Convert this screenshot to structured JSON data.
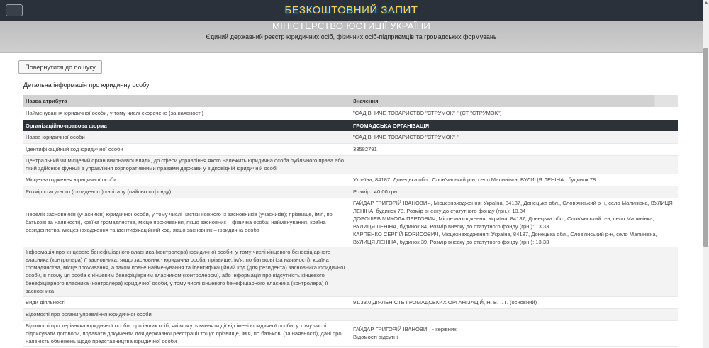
{
  "header": {
    "free_request": "БЕЗКОШТОВНИЙ ЗАПИТ",
    "ministry": "МІНІСТЕРСТВО ЮСТИЦІЇ УКРАЇНИ",
    "registry": "Єдиний державний реєстр юридичних осіб, фізичних осіб-підприємців та громадських формувань"
  },
  "toolbar": {
    "back_label": "Повернутися до пошуку"
  },
  "section_title": "Детальна інформація про юридичну особу",
  "table": {
    "headers": [
      "Назва атрибута",
      "Значення"
    ],
    "rows": [
      {
        "attr": "Найменування юридичної особи, у тому числі скорочене (за наявності)",
        "value": "\"САДІВНИЧЕ ТОВАРИСТВО \"СТРУМОК\" \" (СТ \"СТРУМОК\")"
      },
      {
        "attr": "Організаційно-правова форма",
        "value": "ГРОМАДСЬКА ОРГАНІЗАЦІЯ"
      },
      {
        "attr": "Назва юридичної особи",
        "value": "\"САДІВНИЧЕ ТОВАРИСТВО \"СТРУМОК\" \""
      },
      {
        "attr": "Ідентифікаційний код юридичної особи",
        "value": "33582791"
      },
      {
        "attr": "Центральний чи місцевий орган виконавчої влади, до сфери управління якого належить юридична особа публічного права або який здійснює функції з управління корпоративними правами держави у відповідній юридичній особі",
        "value": ""
      },
      {
        "attr": "Місцезнаходження юридичної особи",
        "value": "Україна, 84187, Донецька обл., Слов'янський р-н, село Малинівка, ВУЛИЦЯ ЛЕНІНА , будинок 78"
      },
      {
        "attr": "Розмір статутного (складеного) капіталу (пайового фонду)",
        "value": "Розмір : 40,00 грн."
      },
      {
        "attr": "Перелік засновників (учасників) юридичної особи, у тому числі частки кожного із засновників (учасників); прізвище, ім'я, по батькові за наявності), країна громадянства, місце проживання, якщо засновник – фізична особа; найменування, країна резидентства, місцезнаходження та ідентифікаційний код, якщо засновник – юридична особа",
        "value": ""
      },
      {
        "attr": "Інформація про кінцевого бенефіціарного власника (контролера) юридичної особи, у тому числі кінцевого бенефіціарного власника (контролера) її засновника, якщо засновник - юридична особа: прізвище, ім'я, по батькові (за наявності), країна громадянства, місце проживання, а також повне найменування та ідентифікаційний код (для резидента) засновника юридичної особи, в якому ця особа є кінцевим бенефіціарним власником (контролером), або інформація про відсутність кінцевого бенефіціарного власника (контролера) юридичної особи, у тому числі кінцевого бенефіціарного власника (контролера) її засновника",
        "value": ""
      },
      {
        "attr": "Види діяльності",
        "value": "91.33.0 ДІЯЛЬНІСТЬ ГРОМАДСЬКИХ ОРГАНІЗАЦІЙ, Н. В. І. Г. (основний)"
      },
      {
        "attr": "Відомості про органи управління юридичної особи",
        "value": ""
      },
      {
        "attr": "Відомості про керівника юридичної особи, про інших осіб, які можуть вчиняти дії від імені юридичної особи, у тому числі підписувати договори, подавати документи для державної реєстрації тощо: прізвище, ім'я, по батькові (за наявності), дані про наявність обмежень щодо представництва юридичної особи",
        "value": ""
      }
    ],
    "founders": [
      "ГАЙДАР ГРИГОРІЙ ІВАНОВИЧ, Місцезнаходження: Україна, 84187, Донецька обл., Слов'янський р-н, село Малинівка, ВУЛИЦЯ ЛЕНІНА, будинок 78, Розмір внеску до статутного фонду (грн.): 13,34",
      "ДОРОШЕВ МИКОЛА ПЕРТОВИЧ, Місцезнаходження: Україна, 84187, Донецька обл., Слов'янський р-н, село Малинівка, ВУЛИЦЯ ЛЕНІНА, будинок 84, Розмір внеску до статутного фонду (грн.): 13,33",
      "КАРПЕНКО СЕРГІЙ БОРИСОВИЧ, Місцезнаходження: Україна, 84187, Донецька обл., Слов'янський р-н, село Малинівка, ВУЛИЦЯ ЛЕНІНА, будинок 39, Розмір внеску до статутного фонду (грн.): 13,33"
    ],
    "head_value_lines": [
      "ГАЙДАР ГРИГОРІЙ ІВАНОВИЧ - керівник",
      "Відомості відсутні"
    ]
  }
}
